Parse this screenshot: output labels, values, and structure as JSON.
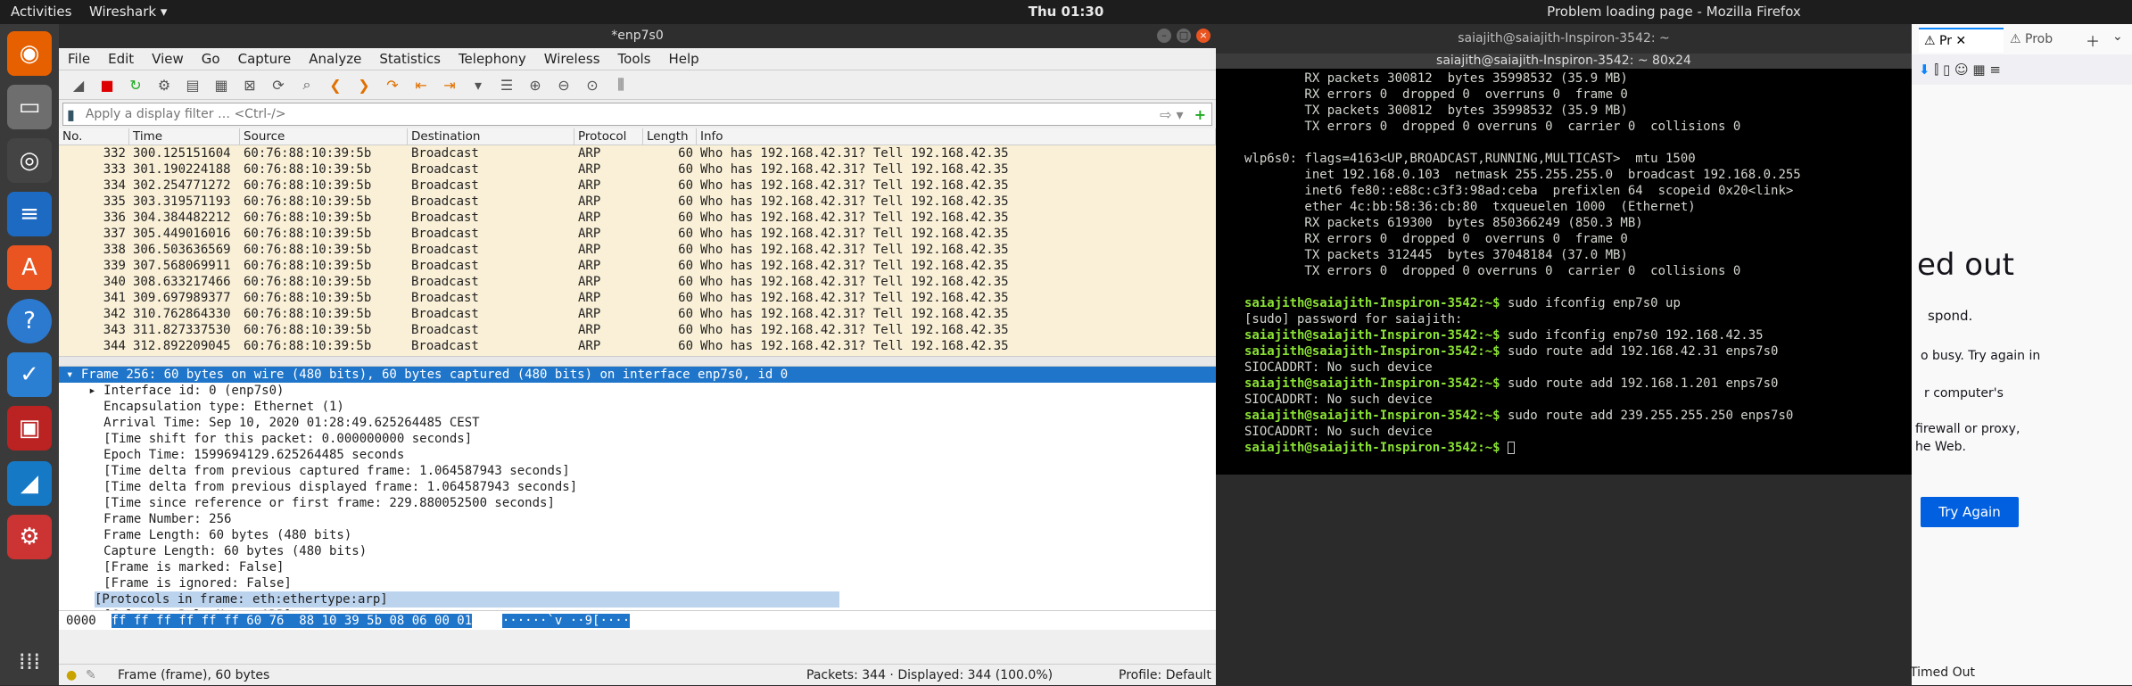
{
  "topbar": {
    "activities": "Activities",
    "app": "Wireshark ▾",
    "clock": "Thu 01:30",
    "tray": [
      "⚙",
      "▾"
    ]
  },
  "ws": {
    "title": "*enp7s0",
    "menu": [
      "File",
      "Edit",
      "View",
      "Go",
      "Capture",
      "Analyze",
      "Statistics",
      "Telephony",
      "Wireless",
      "Tools",
      "Help"
    ],
    "filter_placeholder": "Apply a display filter … <Ctrl-/>",
    "columns": [
      "No.",
      "Time",
      "Source",
      "Destination",
      "Protocol",
      "Length",
      "Info"
    ],
    "packets": [
      [
        "332",
        "300.125151604",
        "60:76:88:10:39:5b",
        "Broadcast",
        "ARP",
        "60",
        "Who has 192.168.42.31? Tell 192.168.42.35"
      ],
      [
        "333",
        "301.190224188",
        "60:76:88:10:39:5b",
        "Broadcast",
        "ARP",
        "60",
        "Who has 192.168.42.31? Tell 192.168.42.35"
      ],
      [
        "334",
        "302.254771272",
        "60:76:88:10:39:5b",
        "Broadcast",
        "ARP",
        "60",
        "Who has 192.168.42.31? Tell 192.168.42.35"
      ],
      [
        "335",
        "303.319571193",
        "60:76:88:10:39:5b",
        "Broadcast",
        "ARP",
        "60",
        "Who has 192.168.42.31? Tell 192.168.42.35"
      ],
      [
        "336",
        "304.384482212",
        "60:76:88:10:39:5b",
        "Broadcast",
        "ARP",
        "60",
        "Who has 192.168.42.31? Tell 192.168.42.35"
      ],
      [
        "337",
        "305.449016016",
        "60:76:88:10:39:5b",
        "Broadcast",
        "ARP",
        "60",
        "Who has 192.168.42.31? Tell 192.168.42.35"
      ],
      [
        "338",
        "306.503636569",
        "60:76:88:10:39:5b",
        "Broadcast",
        "ARP",
        "60",
        "Who has 192.168.42.31? Tell 192.168.42.35"
      ],
      [
        "339",
        "307.568069911",
        "60:76:88:10:39:5b",
        "Broadcast",
        "ARP",
        "60",
        "Who has 192.168.42.31? Tell 192.168.42.35"
      ],
      [
        "340",
        "308.633217466",
        "60:76:88:10:39:5b",
        "Broadcast",
        "ARP",
        "60",
        "Who has 192.168.42.31? Tell 192.168.42.35"
      ],
      [
        "341",
        "309.697989377",
        "60:76:88:10:39:5b",
        "Broadcast",
        "ARP",
        "60",
        "Who has 192.168.42.31? Tell 192.168.42.35"
      ],
      [
        "342",
        "310.762864330",
        "60:76:88:10:39:5b",
        "Broadcast",
        "ARP",
        "60",
        "Who has 192.168.42.31? Tell 192.168.42.35"
      ],
      [
        "343",
        "311.827337530",
        "60:76:88:10:39:5b",
        "Broadcast",
        "ARP",
        "60",
        "Who has 192.168.42.31? Tell 192.168.42.35"
      ],
      [
        "344",
        "312.892209045",
        "60:76:88:10:39:5b",
        "Broadcast",
        "ARP",
        "60",
        "Who has 192.168.42.31? Tell 192.168.42.35"
      ]
    ],
    "detail_selected": "▾ Frame 256: 60 bytes on wire (480 bits), 60 bytes captured (480 bits) on interface enp7s0, id 0",
    "detail": [
      "   ▸ Interface id: 0 (enp7s0)",
      "     Encapsulation type: Ethernet (1)",
      "     Arrival Time: Sep 10, 2020 01:28:49.625264485 CEST",
      "     [Time shift for this packet: 0.000000000 seconds]",
      "     Epoch Time: 1599694129.625264485 seconds",
      "     [Time delta from previous captured frame: 1.064587943 seconds]",
      "     [Time delta from previous displayed frame: 1.064587943 seconds]",
      "     [Time since reference or first frame: 229.880052500 seconds]",
      "     Frame Number: 256",
      "     Frame Length: 60 bytes (480 bits)",
      "     Capture Length: 60 bytes (480 bits)",
      "     [Frame is marked: False]",
      "     [Frame is ignored: False]"
    ],
    "detail_hl": "[Protocols in frame: eth:ethertype:arp]",
    "detail_last": "     [Coloring Rule Name: ARP]",
    "bytes_offset": "0000",
    "bytes_hex": "ff ff ff ff ff ff 60 76  88 10 39 5b 08 06 00 01",
    "bytes_ascii": "······`v ··9[····",
    "status_frame": "Frame (frame), 60 bytes",
    "status_packets": "Packets: 344 · Displayed: 344 (100.0%)",
    "status_profile": "Profile: Default"
  },
  "term": {
    "title": "saiajith@saiajith-Inspiron-3542: ~",
    "subtitle": "saiajith@saiajith-Inspiron-3542: ~ 80x24",
    "lines": [
      {
        "p": "",
        "t": "        RX packets 300812  bytes 35998532 (35.9 MB)"
      },
      {
        "p": "",
        "t": "        RX errors 0  dropped 0  overruns 0  frame 0"
      },
      {
        "p": "",
        "t": "        TX packets 300812  bytes 35998532 (35.9 MB)"
      },
      {
        "p": "",
        "t": "        TX errors 0  dropped 0 overruns 0  carrier 0  collisions 0"
      },
      {
        "p": "",
        "t": ""
      },
      {
        "p": "",
        "t": "wlp6s0: flags=4163<UP,BROADCAST,RUNNING,MULTICAST>  mtu 1500"
      },
      {
        "p": "",
        "t": "        inet 192.168.0.103  netmask 255.255.255.0  broadcast 192.168.0.255"
      },
      {
        "p": "",
        "t": "        inet6 fe80::e88c:c3f3:98ad:ceba  prefixlen 64  scopeid 0x20<link>"
      },
      {
        "p": "",
        "t": "        ether 4c:bb:58:36:cb:80  txqueuelen 1000  (Ethernet)"
      },
      {
        "p": "",
        "t": "        RX packets 619300  bytes 850366249 (850.3 MB)"
      },
      {
        "p": "",
        "t": "        RX errors 0  dropped 0  overruns 0  frame 0"
      },
      {
        "p": "",
        "t": "        TX packets 312445  bytes 37048184 (37.0 MB)"
      },
      {
        "p": "",
        "t": "        TX errors 0  dropped 0 overruns 0  carrier 0  collisions 0"
      },
      {
        "p": "",
        "t": ""
      },
      {
        "p": "saiajith@saiajith-Inspiron-3542:~$",
        "t": " sudo ifconfig enp7s0 up"
      },
      {
        "p": "",
        "t": "[sudo] password for saiajith:"
      },
      {
        "p": "saiajith@saiajith-Inspiron-3542:~$",
        "t": " sudo ifconfig enp7s0 192.168.42.35"
      },
      {
        "p": "saiajith@saiajith-Inspiron-3542:~$",
        "t": " sudo route add 192.168.42.31 enps7s0"
      },
      {
        "p": "",
        "t": "SIOCADDRT: No such device"
      },
      {
        "p": "saiajith@saiajith-Inspiron-3542:~$",
        "t": " sudo route add 192.168.1.201 enps7s0"
      },
      {
        "p": "",
        "t": "SIOCADDRT: No such device"
      },
      {
        "p": "saiajith@saiajith-Inspiron-3542:~$",
        "t": " sudo route add 239.255.255.250 enps7s0"
      },
      {
        "p": "",
        "t": "SIOCADDRT: No such device"
      },
      {
        "p": "saiajith@saiajith-Inspiron-3542:~$",
        "t": " "
      }
    ]
  },
  "ff": {
    "window_title": "Problem loading page - Mozilla Firefox",
    "tab1": "Pr",
    "tab2": "Prob",
    "heading": "ed out",
    "l1": "spond.",
    "l2": "o busy. Try again in",
    "l3": "r computer's",
    "l4": "firewall or proxy,",
    "l5": "he Web.",
    "button": "Try Again",
    "timed_out": "Timed Out"
  }
}
